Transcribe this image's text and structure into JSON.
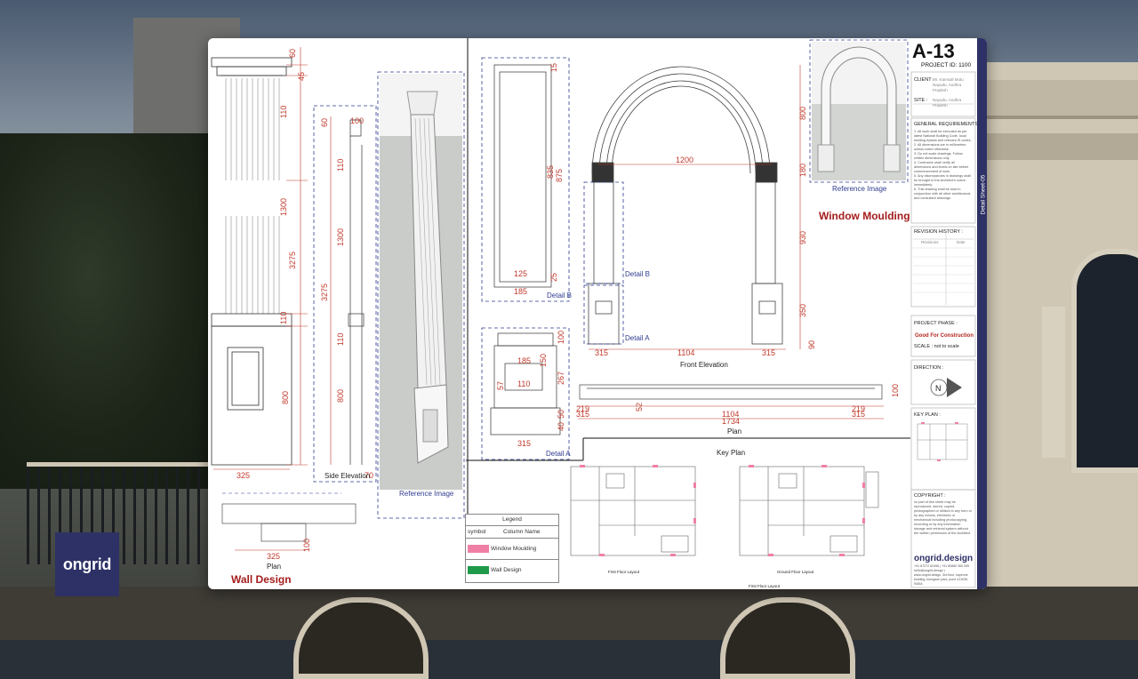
{
  "brand": {
    "name": "ongrid",
    "colors": {
      "navy": "#2d3166",
      "red": "#a41c1c",
      "dim": "#c0392b",
      "blue": "#2f3c8f"
    }
  },
  "sheet": {
    "id": "A-13",
    "project_id": "PROJECT ID: 1100",
    "side_tab": "Detail Sheet-05",
    "client_label": "CLIENT :",
    "client_value": "Mr. Kamsali Motu Nayudu, Andhra Pradesh",
    "site_label": "SITE :",
    "site_value": "Nayudu, Andhra Pradesh",
    "general_requirements_title": "GENERAL REQUIREMENTS :",
    "general_requirements": [
      "1. All work shall be executed as per latest National Building Code, local building bylaws and relevant IS codes.",
      "2. All dimensions are in millimetres unless noted otherwise.",
      "3. Do not scale drawings. Follow written dimensions only.",
      "4. Contractor shall verify all dimensions and levels on site before commencement of work.",
      "5. Any discrepancies in drawings shall be brought to the Architect's notice immediately.",
      "6. This drawing shall be read in conjunction with all other architectural and consultant drawings."
    ],
    "revision_title": "REVISION HISTORY :",
    "revision_cols": [
      "Revisions",
      "Date"
    ],
    "phase_label": "PROJECT PHASE :",
    "phase_value": "Good For Construction",
    "scale_label": "SCALE : not to scale",
    "direction_label": "DIRECTION :",
    "north": "N",
    "keyplan_label": "KEY PLAN :",
    "copyright_title": "COPYRIGHT :",
    "copyright_text": "no part of this sheet may be reproduced, stored, copied, photographed or utilised in any form or by any means, electronic or mechanical including photocopying, recording or by any information storage and retrieval system without the written permission of the Architect.",
    "company": "ongrid.design",
    "contact": "+91 87272 62496 | +91 80880 360 055",
    "address": "hello@ongrid.design | www.ongrid.design, 3rd floor, kayenne building, koregaon park, pune 411036, INDIA"
  },
  "wall_design": {
    "title": "Wall Design",
    "dims_vertical": [
      "60",
      "45",
      "110",
      "1300",
      "3275",
      "110",
      "800"
    ],
    "dim_width": "325",
    "side_elevation": {
      "label": "Side Elevation",
      "dims": [
        "60",
        "100",
        "110",
        "1300",
        "3275",
        "110",
        "800"
      ],
      "bottom": "70"
    },
    "plan": {
      "label": "Plan",
      "width": "325",
      "depth": "100"
    },
    "reference_label": "Reference Image"
  },
  "details": {
    "detail_b": {
      "label": "Detail B",
      "dims": [
        "15",
        "835",
        "875",
        "25",
        "125",
        "185"
      ]
    },
    "detail_a": {
      "label": "Detail A",
      "dims": [
        "185",
        "150",
        "267",
        "57",
        "110",
        "100",
        "50",
        "40",
        "315"
      ]
    }
  },
  "window_moulding": {
    "title": "Window Moulding",
    "front_elevation": "Front Elevation",
    "dims": {
      "span": "1200",
      "inner": "1104",
      "side_left": "315",
      "side_right": "315",
      "h1": "800",
      "h2": "180",
      "h3": "930",
      "h4": "350",
      "h5": "90"
    },
    "detail_b_tag": "Detail B",
    "detail_a_tag": "Detail A",
    "reference_label": "Reference Image",
    "plan": {
      "label": "Plan",
      "dims": [
        "219",
        "315",
        "52",
        "1104",
        "1734",
        "219",
        "315",
        "100"
      ]
    }
  },
  "key_plan": {
    "title": "Key Plan",
    "first_floor": "First Floor Layout",
    "ground_floor": "Ground Floor Layout"
  },
  "legend": {
    "title": "Legend",
    "col_symbol": "symbol",
    "col_name": "Column Name",
    "items": [
      {
        "name": "Window Moulding",
        "color": "#f07fa6"
      },
      {
        "name": "Wall Design",
        "color": "#1f9a4a"
      }
    ]
  }
}
